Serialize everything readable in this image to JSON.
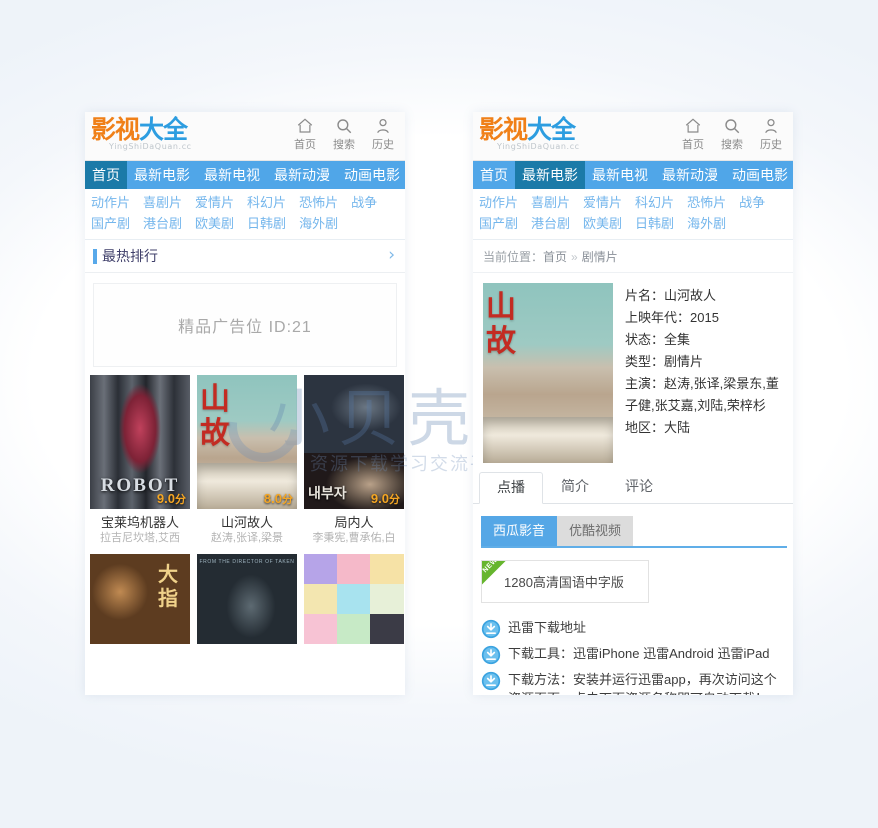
{
  "site": {
    "logo_main_orange": "影视",
    "logo_main_blue": "大全",
    "logo_sub": "YingShiDaQuan.cc",
    "accent_blue": "#50a6e8",
    "accent_orange": "#f08018",
    "active_nav_bg": "#1b7aa8"
  },
  "header_icons": [
    {
      "icon": "home-icon",
      "label": "首页"
    },
    {
      "icon": "search-icon",
      "label": "搜索"
    },
    {
      "icon": "user-icon",
      "label": "历史"
    }
  ],
  "main_nav": [
    {
      "label": "首页",
      "active_left": true,
      "active_right": false
    },
    {
      "label": "最新电影",
      "active_left": false,
      "active_right": true
    },
    {
      "label": "最新电视",
      "active_left": false,
      "active_right": false
    },
    {
      "label": "最新动漫",
      "active_left": false,
      "active_right": false
    },
    {
      "label": "动画电影",
      "active_left": false,
      "active_right": false
    }
  ],
  "sub_nav_row1": [
    "动作片",
    "喜剧片",
    "爱情片",
    "科幻片",
    "恐怖片",
    "战争"
  ],
  "sub_nav_row2": [
    "国产剧",
    "港台剧",
    "欧美剧",
    "日韩剧",
    "海外剧"
  ],
  "left_panel": {
    "section": {
      "title": "最热排行",
      "arrow": "›"
    },
    "ad": {
      "text": "精品广告位 ID:21"
    },
    "row1": [
      {
        "art": "art-robot",
        "score": "9.0",
        "score_unit": "分",
        "title": "宝莱坞机器人",
        "cast": "拉吉尼坎塔,艾西"
      },
      {
        "art": "art-shanhe",
        "score": "8.0",
        "score_unit": "分",
        "title": "山河故人",
        "cast": "赵涛,张译,梁景"
      },
      {
        "art": "art-insider",
        "score": "9.0",
        "score_unit": "分",
        "title": "局内人",
        "cast": "李秉宪,曹承佑,白"
      }
    ],
    "row2": [
      {
        "art": "art-dazhi"
      },
      {
        "art": "art-taken"
      },
      {
        "art": "art-anime"
      }
    ]
  },
  "right_panel": {
    "breadcrumb": {
      "prefix": "当前位置：",
      "home": "首页",
      "sep": "»",
      "current": "剧情片"
    },
    "movie": {
      "lines": [
        "片名：山河故人",
        "上映年代：2015",
        "状态：全集",
        "类型：剧情片",
        "主演：赵涛,张译,梁景东,董子健,张艾嘉,刘陆,荣梓杉",
        "地区：大陆"
      ]
    },
    "detail_tabs": [
      {
        "label": "点播",
        "active": true
      },
      {
        "label": "简介",
        "active": false
      },
      {
        "label": "评论",
        "active": false
      }
    ],
    "source_tabs": [
      {
        "label": "西瓜影音",
        "active": true
      },
      {
        "label": "优酷视频",
        "active": false
      }
    ],
    "chip": {
      "ribbon": "NEW",
      "label": "1280高清国语中字版"
    },
    "notes": [
      {
        "icon": "download-icon",
        "text": "迅雷下载地址"
      },
      {
        "icon": "download-icon",
        "text": "下载工具：迅雷iPhone 迅雷Android 迅雷iPad"
      },
      {
        "icon": "download-icon",
        "text": "下载方法：安装并运行迅雷app，再次访问这个资源页面，点击下面资源名称即可自动下载！"
      }
    ]
  },
  "watermark": {
    "logo": "小贝壳",
    "tagline": "资源下载学习交流平台"
  }
}
